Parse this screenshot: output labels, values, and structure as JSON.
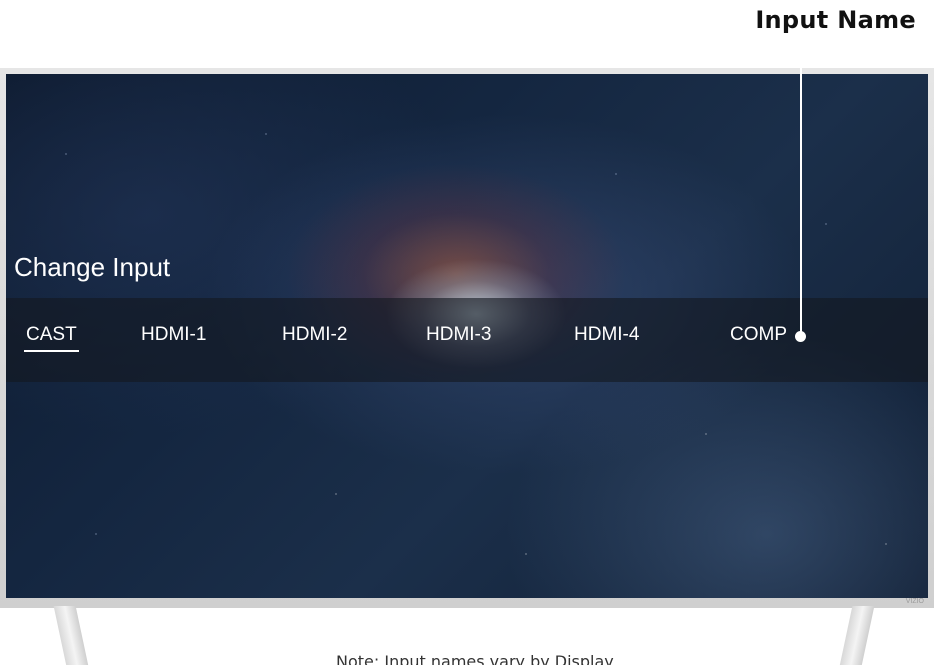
{
  "callout": {
    "label": "Input Name"
  },
  "screen": {
    "title": "Change Input",
    "inputs": [
      {
        "label": "CAST",
        "selected": true
      },
      {
        "label": "HDMI-1",
        "selected": false
      },
      {
        "label": "HDMI-2",
        "selected": false
      },
      {
        "label": "HDMI-3",
        "selected": false
      },
      {
        "label": "HDMI-4",
        "selected": false
      },
      {
        "label": "COMP",
        "selected": false
      }
    ],
    "brand_mark": "VIZIO"
  },
  "footer": {
    "note": "Note: Input names vary by Display"
  },
  "colors": {
    "overlay": "#14182099",
    "text": "#ffffff",
    "callout_text": "#111111"
  }
}
